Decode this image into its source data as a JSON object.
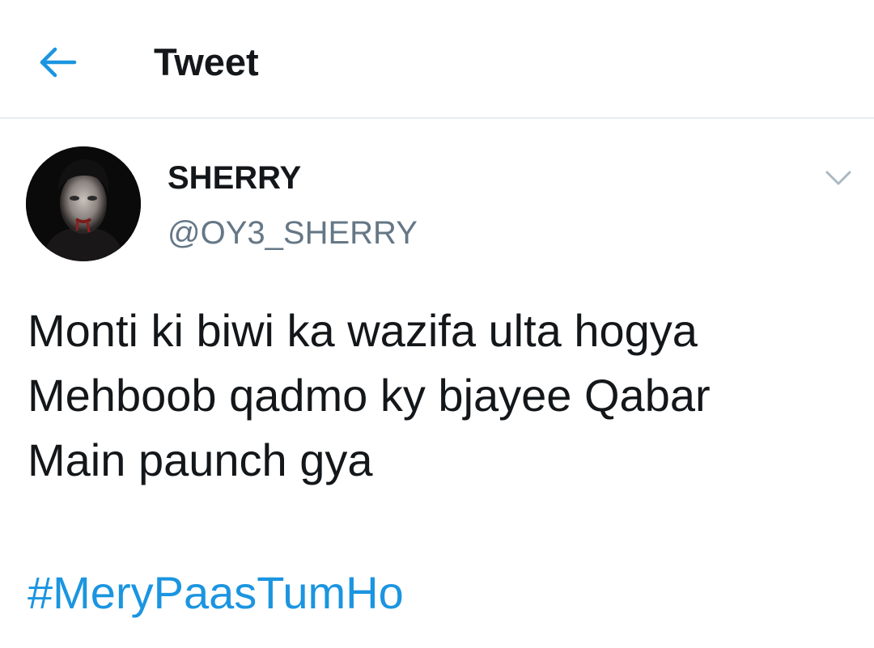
{
  "header": {
    "title": "Tweet",
    "back_icon": "arrow-left-icon",
    "accent_color": "#1b95e0"
  },
  "tweet": {
    "author": {
      "display_name": "SHERRY",
      "handle": "@OY3_SHERRY",
      "avatar": "avatar-photo"
    },
    "menu_icon": "chevron-down-icon",
    "text_lines": [
      "Monti ki biwi ka wazifa ulta hogya",
      "Mehboob qadmo ky bjayee Qabar",
      "Main paunch gya"
    ],
    "hashtag": "#MeryPaasTumHo"
  },
  "colors": {
    "text_primary": "#14171a",
    "text_secondary": "#657786",
    "link": "#1b95e0",
    "divider": "#e6ecf0"
  }
}
